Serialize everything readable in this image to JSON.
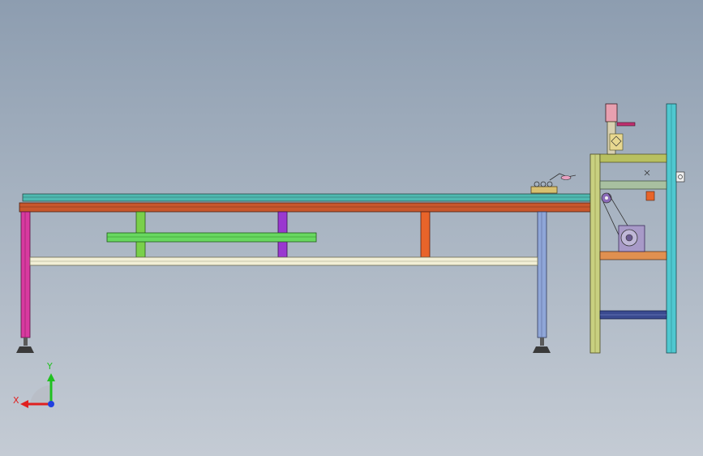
{
  "triad": {
    "x_label": "X",
    "y_label": "Y",
    "x_color": "#e02020",
    "y_color": "#20c020",
    "z_color": "#2040e0"
  },
  "colors": {
    "rail_top": "#4fb9b0",
    "rail_under": "#c8572c",
    "leg_left": "#d83aa0",
    "leg_right": "#8fa6d8",
    "post_green": "#7ad04a",
    "post_purple": "#9a38d0",
    "post_orange": "#e8642a",
    "crossbar_green": "#68d860",
    "crossbar_cream": "#f2efd6",
    "frame_olive": "#c8d080",
    "frame_teal": "#4fc8d0",
    "frame_navy": "#3a4a90",
    "frame_orange": "#e09050",
    "motor": "#8a6ab8",
    "cylinder": "#e8a0b0"
  }
}
